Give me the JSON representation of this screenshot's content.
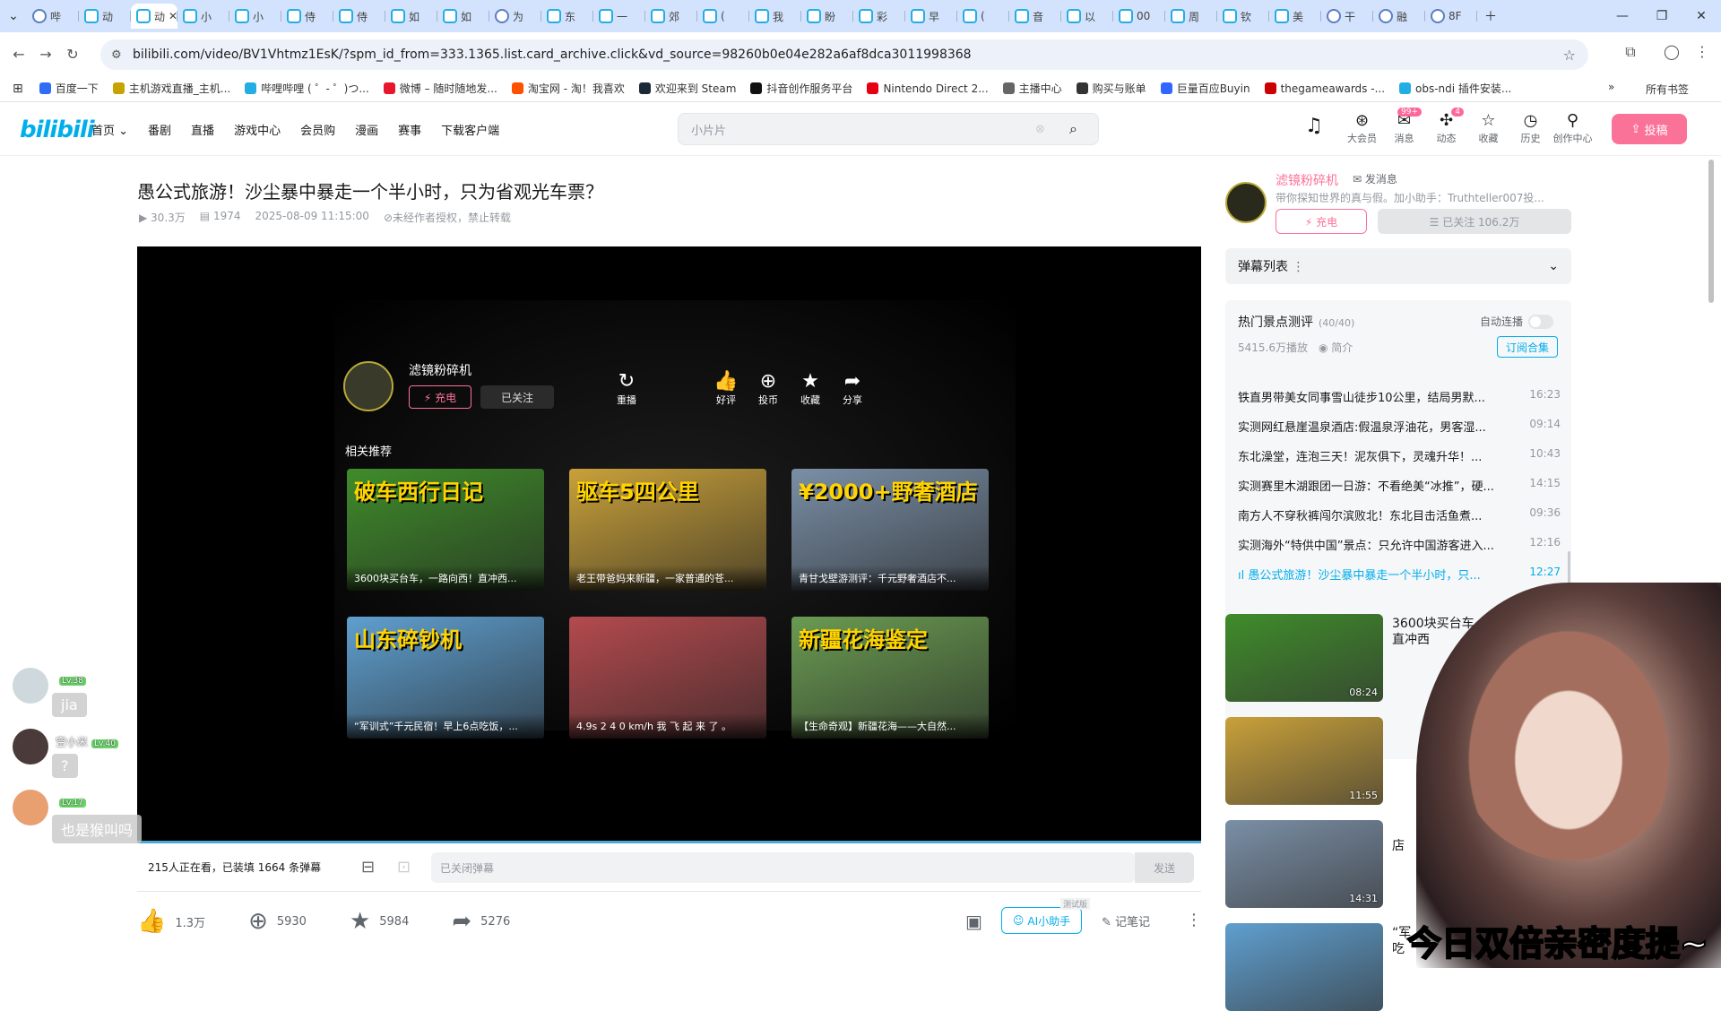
{
  "browser": {
    "tabs": [
      "哔",
      "动",
      "动",
      "小",
      "小",
      "侍",
      "侍",
      "如",
      "如",
      "为",
      "东",
      "一",
      "郊",
      "(",
      "我",
      "盼",
      "彩",
      "早",
      "(",
      "音",
      "以",
      "00",
      "周",
      "钦",
      "美",
      "干",
      "融",
      "8F"
    ],
    "url": "bilibili.com/video/BV1Vhtmz1EsK/?spm_id_from=333.1365.list.card_archive.click&vd_source=98260b0e04e282a6af8dca3011998368",
    "bookmarks": [
      "百度一下",
      "主机游戏直播_主机...",
      "哔哩哔哩 ( ゜- ゜)つ...",
      "微博 – 随时随地发...",
      "淘宝网 - 淘！我喜欢",
      "欢迎来到 Steam",
      "抖音创作服务平台",
      "Nintendo Direct 2...",
      "主播中心",
      "购买与账单",
      "巨量百应Buyin",
      "thegameawards -...",
      "obs-ndi 插件安装..."
    ],
    "all_bookmarks": "所有书签"
  },
  "header": {
    "logo": "bilibili",
    "nav": [
      "首页 ⌄",
      "番剧",
      "直播",
      "游戏中心",
      "会员购",
      "漫画",
      "赛事",
      "下载客户端"
    ],
    "search_placeholder": "小片片",
    "icons": [
      {
        "label": "大会员",
        "glyph": "⊛",
        "badge": ""
      },
      {
        "label": "消息",
        "glyph": "✉",
        "badge": "99+"
      },
      {
        "label": "动态",
        "glyph": "✣",
        "badge": "4"
      },
      {
        "label": "收藏",
        "glyph": "☆",
        "badge": ""
      },
      {
        "label": "历史",
        "glyph": "◷",
        "badge": ""
      },
      {
        "label": "创作中心",
        "glyph": "⚲",
        "badge": ""
      }
    ],
    "upload": "投稿"
  },
  "video": {
    "title": "愚公式旅游！沙尘暴中暴走一个半小时，只为省观光车票？",
    "views": "30.3万",
    "danmaku_count": "1974",
    "date": "2025-08-09 11:15:00",
    "copyright": "未经作者授权，禁止转载"
  },
  "player": {
    "up_name": "滤镜粉碎机",
    "charge": "⚡ 充电",
    "followed": "已关注",
    "actions": [
      {
        "glyph": "↻",
        "label": "重播"
      },
      {
        "glyph": "👍",
        "label": "好评"
      },
      {
        "glyph": "⊕",
        "label": "投币"
      },
      {
        "glyph": "★",
        "label": "收藏"
      },
      {
        "glyph": "➦",
        "label": "分享"
      }
    ],
    "related_title": "相关推荐",
    "related": [
      {
        "headline": "破车西行日记",
        "caption": "3600块买台车，一路向西！直冲西...",
        "color": "#3f8c2a"
      },
      {
        "headline": "驱车5四公里",
        "caption": "老王带爸妈来新疆，一家普通的苍...",
        "color": "#c9a13a"
      },
      {
        "headline": "¥2000+野奢酒店",
        "caption": "青甘戈壁游测评：千元野奢酒店不...",
        "color": "#7a8fa6"
      },
      {
        "headline": "山东碎钞机",
        "caption": "“军训式”千元民宿！早上6点吃饭，...",
        "color": "#5f9fcf"
      },
      {
        "headline": "",
        "caption": "4.9s 2 4 0 km/h 我 飞 起 来 了 。",
        "color": "#b44a4e"
      },
      {
        "headline": "新疆花海鉴定",
        "caption": "【生命奇观】新疆花海——大自然...",
        "color": "#6a9b52"
      }
    ]
  },
  "danmaku_bar": {
    "watching": "215人正在看，已装填 1664 条弹幕",
    "placeholder": "已关闭弹幕",
    "send": "发送"
  },
  "toolbar": {
    "like": "1.3万",
    "coin": "5930",
    "fav": "5984",
    "share": "5276",
    "ai": "AI小助手",
    "ai_tag": "测试版",
    "note": "记笔记"
  },
  "sidebar": {
    "up_name": "滤镜粉碎机",
    "send_msg": "发消息",
    "desc": "带你探知世界的真与假。加小助手：Truthteller007投...",
    "charge": "⚡ 充电",
    "follow": "☰ 已关注 106.2万",
    "danmaku_list": "弹幕列表",
    "collection": {
      "title": "热门景点测评",
      "count": "(40/40)",
      "autoplay": "自动连播",
      "plays": "5415.6万播放",
      "intro": "◉ 简介",
      "subscribe": "订阅合集",
      "episodes": [
        {
          "title": "铁直男带美女同事雪山徒步10公里，结局男默...",
          "time": "16:23"
        },
        {
          "title": "实测网红悬崖温泉酒店:假温泉浮油花，男客湿...",
          "time": "09:14"
        },
        {
          "title": "东北澡堂，连泡三天！泥灰俱下，灵魂升华！...",
          "time": "10:43"
        },
        {
          "title": "实测赛里木湖跟团一日游：不看绝美“冰推”，硬...",
          "time": "14:15"
        },
        {
          "title": "南方人不穿秋裤闯尔滨败北！东北目击活鱼煮...",
          "time": "09:36"
        },
        {
          "title": "实测海外“特供中国”景点：只允许中国游客进入...",
          "time": "12:16"
        },
        {
          "title": "ıl 愚公式旅游！沙尘暴中暴走一个半小时，只...",
          "time": "12:27"
        }
      ]
    },
    "recs": [
      {
        "title": "3600块买台车",
        "title2": "直冲西",
        "dur": "08:24",
        "color": "#3f8c2a"
      },
      {
        "title": "",
        "title2": "",
        "dur": "11:55",
        "color": "#c9a13a"
      },
      {
        "title": "",
        "title2": "店",
        "dur": "14:31",
        "color": "#7a8fa6"
      },
      {
        "title": "“军",
        "title2": "吃",
        "dur": "",
        "color": "#5f9fcf"
      }
    ]
  },
  "livechat": [
    {
      "name": "",
      "level": "Lv.38",
      "msg": "jia"
    },
    {
      "name": "空小米",
      "level": "Lv.40",
      "msg": "?"
    },
    {
      "name": "",
      "level": "Lv.17",
      "msg": "也是猴叫吗"
    }
  ],
  "stream_overlay": "今日双倍亲密度提~"
}
